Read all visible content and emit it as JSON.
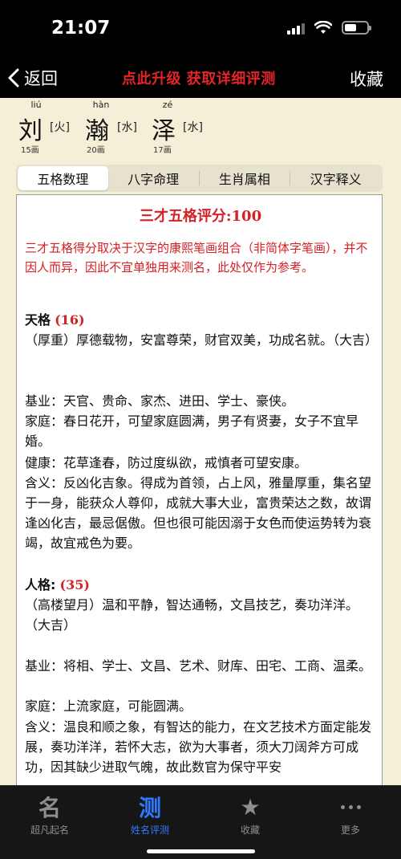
{
  "status": {
    "time": "21:07"
  },
  "nav": {
    "back_label": "返回",
    "upgrade_label": "点此升级 获取详细评测",
    "favorite_label": "收藏"
  },
  "name": [
    {
      "pinyin": "liú",
      "char": "刘",
      "element": "[火]",
      "strokes": "15画"
    },
    {
      "pinyin": "hàn",
      "char": "瀚",
      "element": "[水]",
      "strokes": "20画"
    },
    {
      "pinyin": "zé",
      "char": "泽",
      "element": "[水]",
      "strokes": "17画"
    }
  ],
  "tabs": [
    "五格数理",
    "八字命理",
    "生肖属相",
    "汉字释义"
  ],
  "score": {
    "title": "三才五格评分:100",
    "note": "三才五格得分取决于汉字的康熙笔画组合（非简体字笔画），并不因人而异，因此不宜单独用来测名，此处仅作为参考。"
  },
  "tiange": {
    "label": "天格",
    "number": "(16)",
    "summary": "（厚重）厚德载物，安富尊荣，财官双美，功成名就。（大吉）",
    "jiye": "基业：天官、贵命、家杰、进田、学士、豪侠。",
    "jiating": "家庭：春日花开，可望家庭圆满，男子有贤妻，女子不宜早婚。",
    "jiankang": "健康：花草逢春，防过度纵欲，戒慎者可望安康。",
    "hanyi": "含义：反凶化吉象。得成为首领，占上风，雅量厚重，集名望于一身，能获众人尊仰，成就大事大业，富贵荣达之数，故谓逢凶化吉，最忌倨傲。但也很可能因溺于女色而使运势转为衰竭，故宜戒色为要。"
  },
  "renge": {
    "label": "人格:",
    "number": "(35)",
    "summary": "（高楼望月）温和平静，智达通畅，文昌技艺，奏功洋洋。（大吉）",
    "jiye": "基业：将相、学士、文昌、艺术、财库、田宅、工商、温柔。",
    "jiating": "家庭：上流家庭，可能圆满。",
    "hanyi": "含义：温良和顺之象，有智达的能力，在文艺技术方面定能发展，奏功洋洋，若怀大志，欲为大事者，须大刀阔斧方可成功，因其缺少进取气魄，故此数官为保守平安"
  },
  "tabbar": [
    {
      "icon": "名",
      "label": "超凡起名"
    },
    {
      "icon": "测",
      "label": "姓名评测"
    },
    {
      "icon": "★",
      "label": "收藏"
    },
    {
      "icon": "",
      "label": "更多"
    }
  ]
}
